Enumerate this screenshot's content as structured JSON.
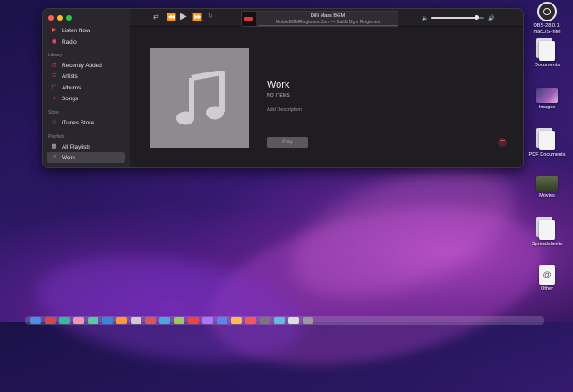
{
  "window": {
    "sidebar": {
      "items_top": [
        {
          "label": "Listen Now",
          "icon": "play-circle-icon"
        },
        {
          "label": "Radio",
          "icon": "radio-icon"
        }
      ],
      "library_header": "Library",
      "library_items": [
        {
          "label": "Recently Added",
          "icon": "clock-icon"
        },
        {
          "label": "Artists",
          "icon": "microphone-icon"
        },
        {
          "label": "Albums",
          "icon": "album-icon"
        },
        {
          "label": "Songs",
          "icon": "note-icon"
        }
      ],
      "store_header": "Store",
      "store_items": [
        {
          "label": "iTunes Store",
          "icon": "star-icon"
        }
      ],
      "playlists_header": "Playlists",
      "playlist_items": [
        {
          "label": "All Playlists",
          "icon": "grid-icon"
        },
        {
          "label": "Work",
          "icon": "playlist-icon",
          "selected": true
        }
      ]
    },
    "now_playing": {
      "title": "Dilli Mass BGM",
      "subtitle": "MobileBGMRingtones.Com — Kaithi Bgm Ringtones"
    },
    "playlist": {
      "title": "Work",
      "count": "NO ITEMS",
      "description_placeholder": "Add Description",
      "play_label": "Play"
    },
    "volume_level": 0.85
  },
  "desktop": {
    "items": [
      {
        "label": "OBS-28.0.1-macOS-Intel",
        "icon": "obs-app-icon"
      },
      {
        "label": "Documents",
        "icon": "folder-documents-icon"
      },
      {
        "label": "Images",
        "icon": "images-thumbnail-icon"
      },
      {
        "label": "PDF Documents",
        "icon": "pdf-documents-icon"
      },
      {
        "label": "Movies",
        "icon": "movies-thumbnail-icon"
      },
      {
        "label": "Spreadsheets",
        "icon": "spreadsheet-stack-icon"
      },
      {
        "label": "Other",
        "icon": "other-document-icon"
      }
    ]
  },
  "colors": {
    "accent": "#ff4a5f",
    "window_bg": "#1f1d22",
    "sidebar_bg": "#2a262d"
  }
}
